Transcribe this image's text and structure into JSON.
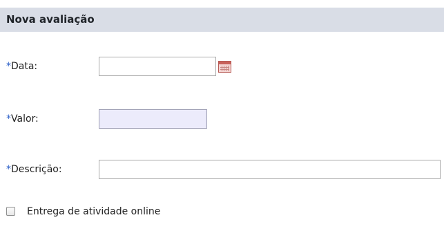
{
  "panel": {
    "title": "Nova avaliação"
  },
  "form": {
    "data": {
      "required_mark": "*",
      "label": "Data:",
      "value": "",
      "calendar_icon": "calendar-icon"
    },
    "valor": {
      "required_mark": "*",
      "label": "Valor:",
      "value": ""
    },
    "descricao": {
      "required_mark": "*",
      "label": "Descrição:",
      "value": ""
    },
    "entrega_online": {
      "label": "Entrega de atividade online",
      "checked": false
    }
  },
  "colors": {
    "header_bg": "#d9dde6",
    "required_mark": "#2f62c9",
    "disabled_input_bg": "#ecebfb"
  }
}
